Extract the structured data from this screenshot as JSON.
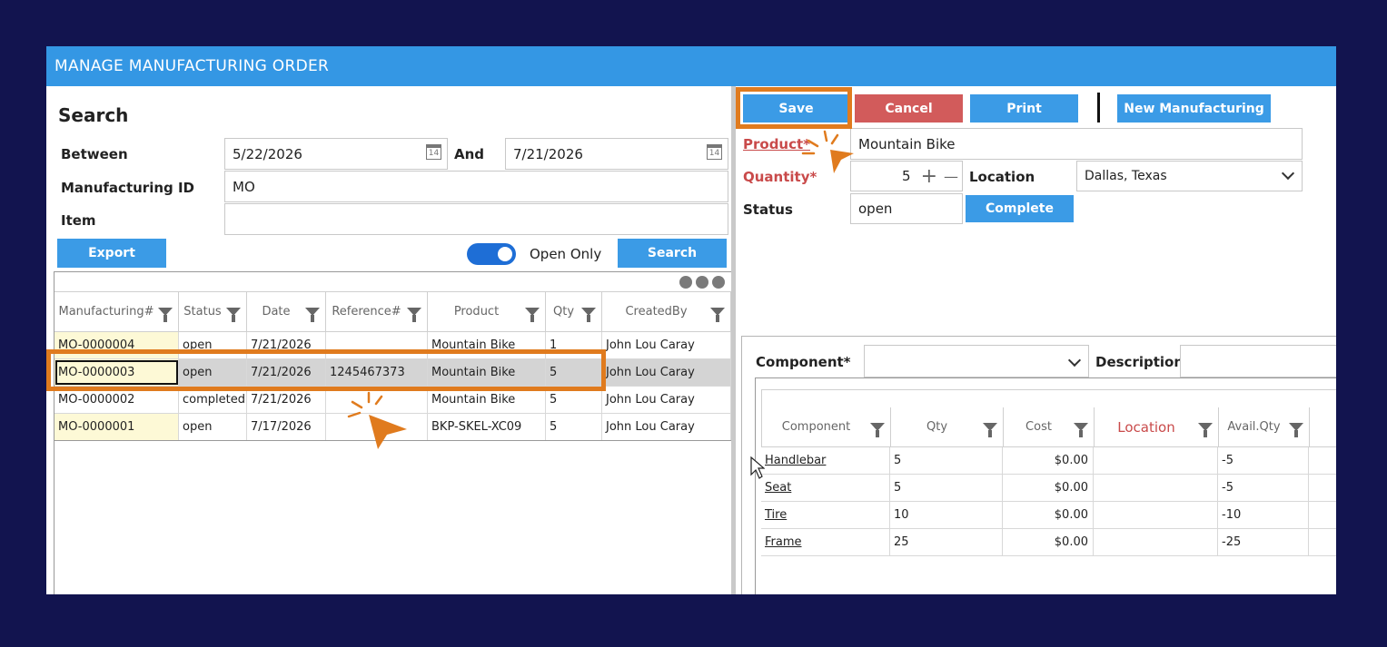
{
  "window": {
    "title": "MANAGE MANUFACTURING ORDER"
  },
  "search": {
    "heading": "Search",
    "between_label": "Between",
    "date_from": "5/22/2026",
    "and_label": "And",
    "date_to": "7/21/2026",
    "manufacturing_id_label": "Manufacturing ID",
    "manufacturing_id_value": "MO",
    "item_label": "Item",
    "item_value": "",
    "calendar_icon_text": "14",
    "export_label": "Export",
    "open_only_label": "Open Only",
    "open_only_on": true,
    "search_label": "Search"
  },
  "orders_table": {
    "columns": [
      "Manufacturing#",
      "Status",
      "Date",
      "Reference#",
      "Product",
      "Qty",
      "CreatedBy"
    ],
    "rows": [
      [
        "MO-0000004",
        "open",
        "7/21/2026",
        "",
        "Mountain Bike",
        "1",
        "John Lou Caray"
      ],
      [
        "MO-0000003",
        "open",
        "7/21/2026",
        "1245467373",
        "Mountain Bike",
        "5",
        "John Lou Caray"
      ],
      [
        "MO-0000002",
        "completed",
        "7/21/2026",
        "",
        "Mountain Bike",
        "5",
        "John Lou Caray"
      ],
      [
        "MO-0000001",
        "open",
        "7/17/2026",
        "",
        "BKP-SKEL-XC09",
        "5",
        "John Lou Caray"
      ]
    ],
    "selected_row": 1
  },
  "toolbar": {
    "save_label": "Save",
    "cancel_label": "Cancel",
    "print_label": "Print",
    "new_label": "New Manufacturing"
  },
  "form": {
    "product_label": "Product*",
    "product_value": "Mountain Bike",
    "quantity_label": "Quantity*",
    "quantity_value": "5",
    "plus_glyph": "+",
    "minus_glyph": "—",
    "location_label": "Location",
    "location_value": "Dallas, Texas",
    "status_label": "Status",
    "status_value": "open",
    "complete_label": "Complete"
  },
  "components": {
    "component_label": "Component*",
    "component_value": "",
    "description_label": "Description",
    "description_value": "",
    "columns": [
      "Component",
      "Qty",
      "Cost",
      "Location",
      "Avail.Qty"
    ],
    "rows": [
      [
        "Handlebar",
        "5",
        "$0.00",
        "",
        "-5"
      ],
      [
        "Seat",
        "5",
        "$0.00",
        "",
        "-5"
      ],
      [
        "Tire",
        "10",
        "$0.00",
        "",
        "-10"
      ],
      [
        "Frame",
        "25",
        "$0.00",
        "",
        "-25"
      ]
    ]
  },
  "colors": {
    "background": "#12144f",
    "titlebar": "#3497e4",
    "button_blue": "#3b9be6",
    "button_red": "#d25b5b",
    "highlight_orange": "#e07b1e",
    "required_red": "#c94a4a",
    "id_cell_yellow": "#fdf9d6",
    "selected_row": "#d4d4d4"
  },
  "icons": [
    "calendar-icon",
    "filter-icon",
    "more-dots-icon",
    "chevron-down-icon",
    "plus-icon",
    "minus-icon",
    "pointer-arrow-icon",
    "mouse-cursor-icon"
  ]
}
